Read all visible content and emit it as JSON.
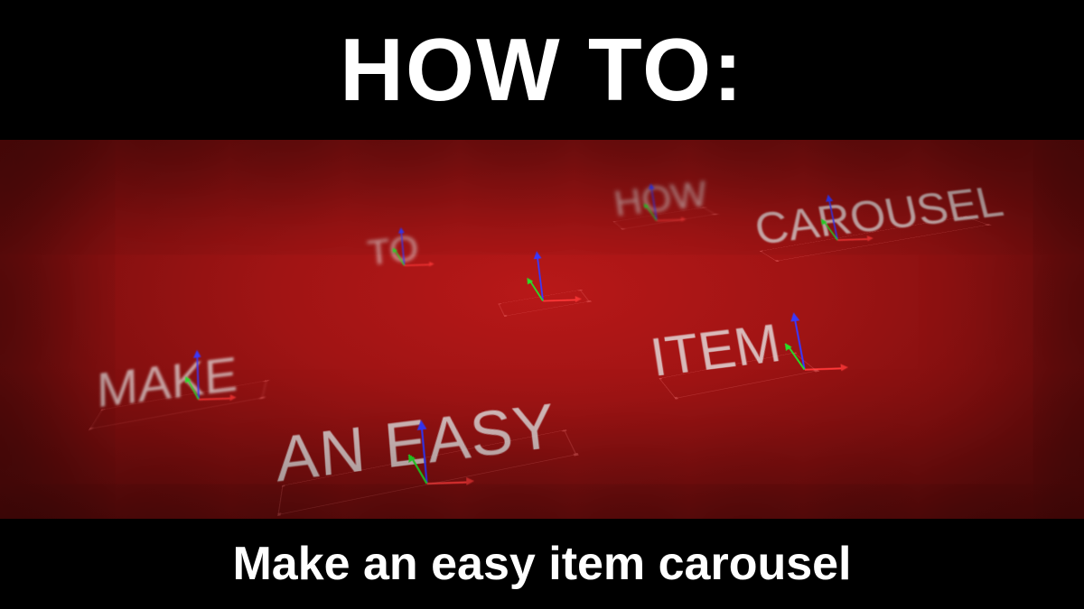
{
  "header": {
    "title": "HOW TO:"
  },
  "footer": {
    "subtitle": "Make an easy item carousel"
  },
  "scene": {
    "words": {
      "how": "HOW",
      "to": "TO",
      "carousel": "CAROUSEL",
      "make": "MAKE",
      "item": "ITEM",
      "aneasy": "AN EASY"
    },
    "background_color": "#a01414",
    "gizmo_colors": {
      "x": "#ff3838",
      "y": "#3838ff",
      "z": "#28e028"
    }
  }
}
